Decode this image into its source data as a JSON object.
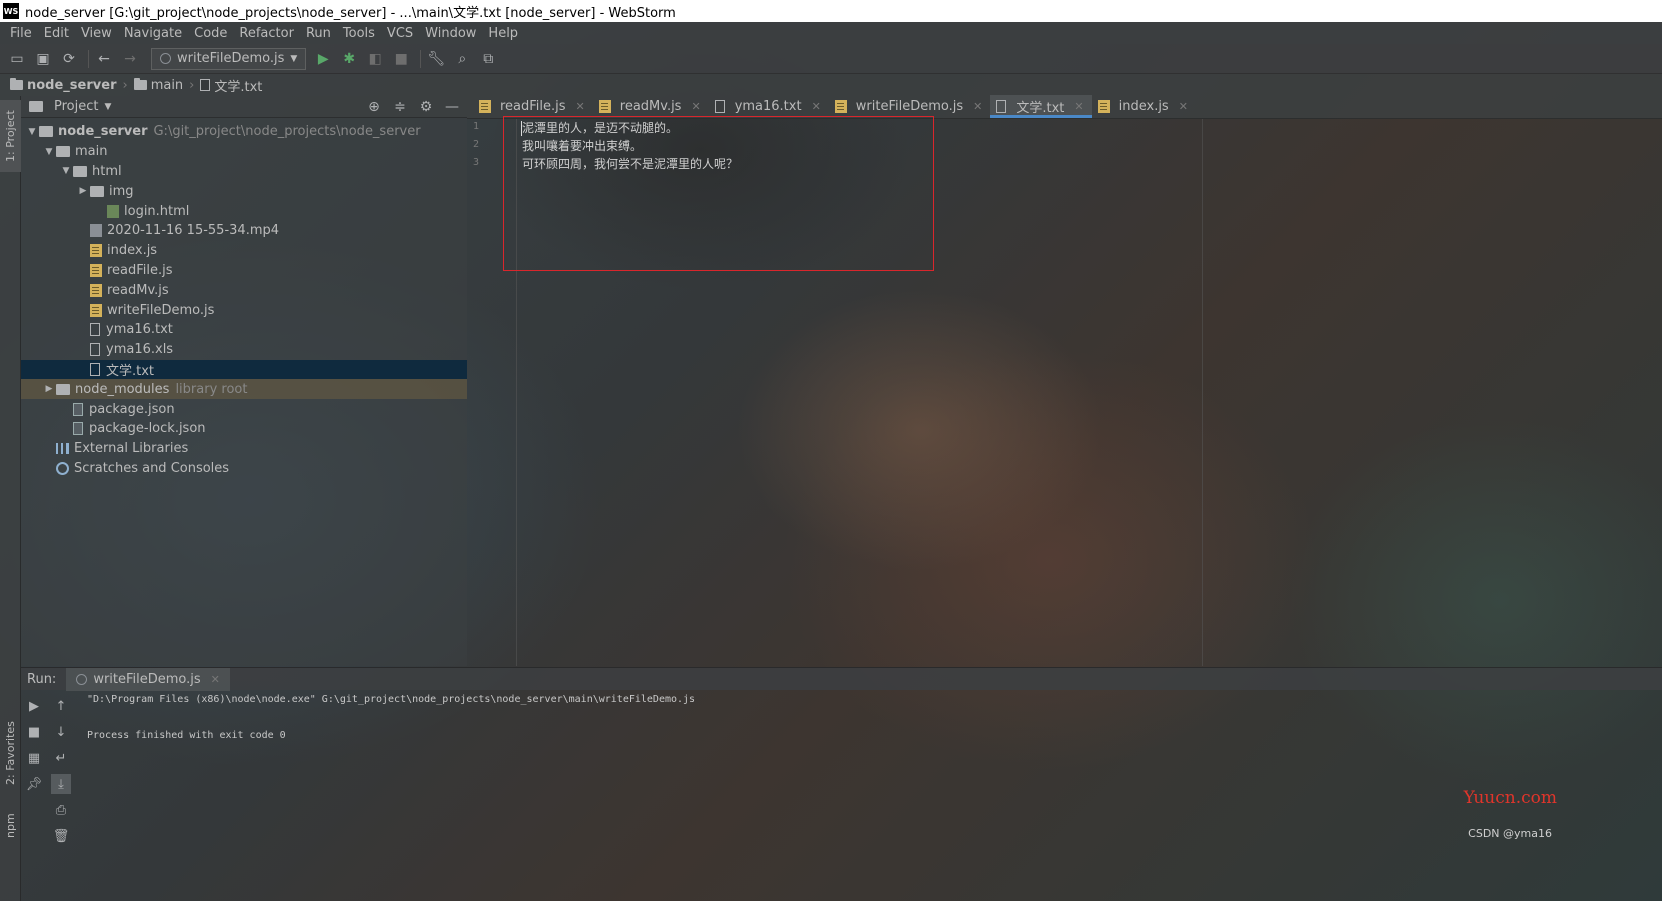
{
  "window": {
    "title": "node_server [G:\\git_project\\node_projects\\node_server] - ...\\main\\文学.txt [node_server] - WebStorm",
    "logo_text": "WS"
  },
  "menu": [
    "File",
    "Edit",
    "View",
    "Navigate",
    "Code",
    "Refactor",
    "Run",
    "Tools",
    "VCS",
    "Window",
    "Help"
  ],
  "toolbar": {
    "run_config": "writeFileDemo.js",
    "icons": [
      "open-icon",
      "save-icon",
      "sync-icon",
      "back-icon",
      "forward-icon",
      "run-icon",
      "debug-icon",
      "coverage-icon",
      "stop-icon",
      "wrench-icon",
      "search-icon",
      "translate-icon"
    ]
  },
  "breadcrumb": [
    "node_server",
    "main",
    "文学.txt"
  ],
  "left_strip": {
    "project_tab": "1: Project",
    "favorites_tab": "2: Favorites",
    "npm_tab": "npm"
  },
  "project_panel": {
    "title": "Project",
    "tree": [
      {
        "label": "node_server",
        "extra": "G:\\git_project\\node_projects\\node_server",
        "type": "folder",
        "depth": 0,
        "expanded": true
      },
      {
        "label": "main",
        "type": "folder",
        "depth": 1,
        "expanded": true
      },
      {
        "label": "html",
        "type": "folder",
        "depth": 2,
        "expanded": true
      },
      {
        "label": "img",
        "type": "folder",
        "depth": 3,
        "expanded": false
      },
      {
        "label": "login.html",
        "type": "html",
        "depth": 4
      },
      {
        "label": "2020-11-16 15-55-34.mp4",
        "type": "media",
        "depth": 3
      },
      {
        "label": "index.js",
        "type": "js",
        "depth": 3
      },
      {
        "label": "readFile.js",
        "type": "js",
        "depth": 3
      },
      {
        "label": "readMv.js",
        "type": "js",
        "depth": 3
      },
      {
        "label": "writeFileDemo.js",
        "type": "js",
        "depth": 3
      },
      {
        "label": "yma16.txt",
        "type": "txt",
        "depth": 3
      },
      {
        "label": "yma16.xls",
        "type": "txt",
        "depth": 3
      },
      {
        "label": "文学.txt",
        "type": "txt",
        "depth": 3,
        "selected": true
      },
      {
        "label": "node_modules",
        "extra": "library root",
        "type": "folder",
        "depth": 1,
        "expanded": false,
        "libroot": true
      },
      {
        "label": "package.json",
        "type": "json",
        "depth": 2
      },
      {
        "label": "package-lock.json",
        "type": "json",
        "depth": 2
      },
      {
        "label": "External Libraries",
        "type": "lib",
        "depth": 1
      },
      {
        "label": "Scratches and Consoles",
        "type": "scratch",
        "depth": 1
      }
    ]
  },
  "editor": {
    "tabs": [
      {
        "label": "readFile.js",
        "type": "js"
      },
      {
        "label": "readMv.js",
        "type": "js"
      },
      {
        "label": "yma16.txt",
        "type": "txt"
      },
      {
        "label": "writeFileDemo.js",
        "type": "js"
      },
      {
        "label": "文学.txt",
        "type": "txt",
        "active": true
      },
      {
        "label": "index.js",
        "type": "js"
      }
    ],
    "line_numbers": [
      "1",
      "2",
      "3"
    ],
    "lines": [
      "泥潭里的人，是迈不动腿的。",
      "我叫嚷着要冲出束缚。",
      "可环顾四周，我何尝不是泥潭里的人呢？"
    ]
  },
  "run_panel": {
    "label": "Run:",
    "tab": "writeFileDemo.js",
    "console": [
      "\"D:\\Program Files (x86)\\node\\node.exe\" G:\\git_project\\node_projects\\node_server\\main\\writeFileDemo.js",
      "",
      "Process finished with exit code 0"
    ]
  },
  "watermarks": {
    "site": "Yuucn.com",
    "author": "CSDN @yma16"
  },
  "colors": {
    "selection": "#0d293e",
    "highlight_box": "#d9262c",
    "active_tab_underline": "#4a88c7",
    "run_green": "#59a869"
  }
}
